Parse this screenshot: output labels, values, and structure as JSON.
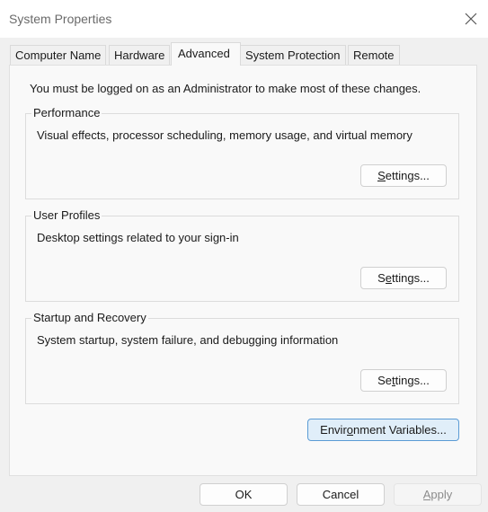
{
  "window": {
    "title": "System Properties",
    "close_icon": "close-icon"
  },
  "tabs": [
    {
      "label": "Computer Name"
    },
    {
      "label": "Hardware"
    },
    {
      "label": "Advanced",
      "active": true
    },
    {
      "label": "System Protection"
    },
    {
      "label": "Remote"
    }
  ],
  "advanced": {
    "notice": "You must be logged on as an Administrator to make most of these changes.",
    "groups": [
      {
        "title": "Performance",
        "description": "Visual effects, processor scheduling, memory usage, and virtual memory",
        "button": {
          "label": "Settings...",
          "access_key_index": 0
        }
      },
      {
        "title": "User Profiles",
        "description": "Desktop settings related to your sign-in",
        "button": {
          "label": "Settings...",
          "access_key_index": 1
        }
      },
      {
        "title": "Startup and Recovery",
        "description": "System startup, system failure, and debugging information",
        "button": {
          "label": "Settings...",
          "access_key_index": 2
        }
      }
    ],
    "env_button": {
      "label": "Environment Variables...",
      "access_key_index": 5
    }
  },
  "footer": {
    "ok": {
      "label": "OK"
    },
    "cancel": {
      "label": "Cancel"
    },
    "apply": {
      "label": "Apply",
      "access_key_index": 0,
      "disabled": true
    }
  },
  "colors": {
    "accent_border": "#5b9bd5",
    "accent_bg": "#e0eef9"
  }
}
